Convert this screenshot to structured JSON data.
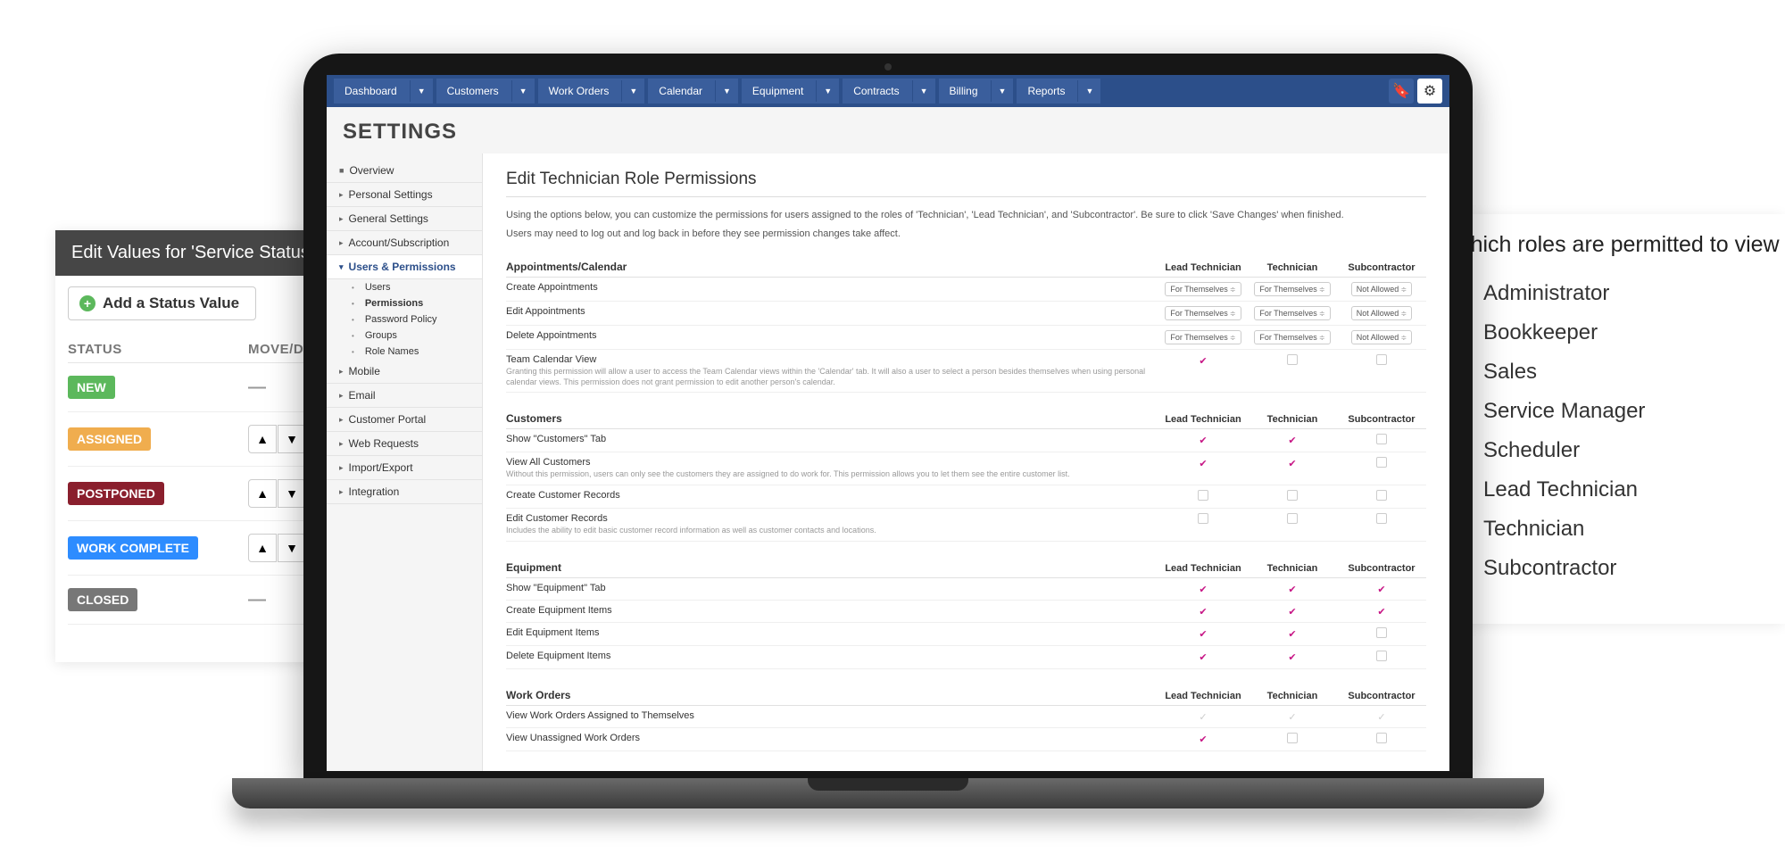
{
  "status_panel": {
    "title": "Edit Values for 'Service Status'",
    "add_button": "Add a Status Value",
    "col_status": "STATUS",
    "col_move": "MOVE/DELETE",
    "rows": [
      {
        "label": "NEW",
        "color": "#5cb85c",
        "movable": false
      },
      {
        "label": "ASSIGNED",
        "color": "#f0ad4e",
        "movable": true
      },
      {
        "label": "POSTPONED",
        "color": "#8a1f2d",
        "movable": true
      },
      {
        "label": "WORK COMPLETE",
        "color": "#2d8cff",
        "movable": true
      },
      {
        "label": "CLOSED",
        "color": "#777777",
        "movable": false
      }
    ]
  },
  "roles_panel": {
    "title": "Which roles are permitted to view",
    "roles": [
      {
        "label": "Administrator",
        "checked": true
      },
      {
        "label": "Bookkeeper",
        "checked": false
      },
      {
        "label": "Sales",
        "checked": false
      },
      {
        "label": "Service Manager",
        "checked": false
      },
      {
        "label": "Scheduler",
        "checked": false
      },
      {
        "label": "Lead Technician",
        "checked": false
      },
      {
        "label": "Technician",
        "checked": false
      },
      {
        "label": "Subcontractor",
        "checked": false
      }
    ]
  },
  "nav": {
    "items": [
      "Dashboard",
      "Customers",
      "Work Orders",
      "Calendar",
      "Equipment",
      "Contracts",
      "Billing",
      "Reports"
    ]
  },
  "page_title": "SETTINGS",
  "sidebar": {
    "items": [
      {
        "label": "Overview",
        "arrow": "■"
      },
      {
        "label": "Personal Settings",
        "arrow": "▸"
      },
      {
        "label": "General Settings",
        "arrow": "▸"
      },
      {
        "label": "Account/Subscription",
        "arrow": "▸"
      },
      {
        "label": "Users & Permissions",
        "arrow": "▾",
        "active": true,
        "subs": [
          {
            "label": "Users"
          },
          {
            "label": "Permissions",
            "active": true
          },
          {
            "label": "Password Policy"
          },
          {
            "label": "Groups"
          },
          {
            "label": "Role Names"
          }
        ]
      },
      {
        "label": "Mobile",
        "arrow": "▸"
      },
      {
        "label": "Email",
        "arrow": "▸"
      },
      {
        "label": "Customer Portal",
        "arrow": "▸"
      },
      {
        "label": "Web Requests",
        "arrow": "▸"
      },
      {
        "label": "Import/Export",
        "arrow": "▸"
      },
      {
        "label": "Integration",
        "arrow": "▸"
      }
    ]
  },
  "main": {
    "title": "Edit Technician Role Permissions",
    "desc1": "Using the options below, you can customize the permissions for users assigned to the roles of 'Technician', 'Lead Technician', and 'Subcontractor'. Be sure to click 'Save Changes' when finished.",
    "desc2": "Users may need to log out and log back in before they see permission changes take affect.",
    "cols": [
      "Lead Technician",
      "Technician",
      "Subcontractor"
    ],
    "sections": [
      {
        "title": "Appointments/Calendar",
        "rows": [
          {
            "label": "Create Appointments",
            "cells": [
              "select:For Themselves",
              "select:For Themselves",
              "select:Not Allowed"
            ]
          },
          {
            "label": "Edit Appointments",
            "cells": [
              "select:For Themselves",
              "select:For Themselves",
              "select:Not Allowed"
            ]
          },
          {
            "label": "Delete Appointments",
            "cells": [
              "select:For Themselves",
              "select:For Themselves",
              "select:Not Allowed"
            ]
          },
          {
            "label": "Team Calendar View",
            "sub": "Granting this permission will allow a user to access the Team Calendar views within the 'Calendar' tab. It will also a user to select a person besides themselves when using personal calendar views. This permission does not grant permission to edit another person's calendar.",
            "cells": [
              "on",
              "off",
              "off"
            ]
          }
        ]
      },
      {
        "title": "Customers",
        "rows": [
          {
            "label": "Show \"Customers\" Tab",
            "cells": [
              "on",
              "on",
              "off"
            ]
          },
          {
            "label": "View All Customers",
            "sub": "Without this permission, users can only see the customers they are assigned to do work for. This permission allows you to let them see the entire customer list.",
            "cells": [
              "on",
              "on",
              "off"
            ]
          },
          {
            "label": "Create Customer Records",
            "cells": [
              "off",
              "off",
              "off"
            ]
          },
          {
            "label": "Edit Customer Records",
            "sub": "Includes the ability to edit basic customer record information as well as customer contacts and locations.",
            "cells": [
              "off",
              "off",
              "off"
            ]
          }
        ]
      },
      {
        "title": "Equipment",
        "rows": [
          {
            "label": "Show \"Equipment\" Tab",
            "cells": [
              "on",
              "on",
              "on"
            ]
          },
          {
            "label": "Create Equipment Items",
            "cells": [
              "on",
              "on",
              "on"
            ]
          },
          {
            "label": "Edit Equipment Items",
            "cells": [
              "on",
              "on",
              "off"
            ]
          },
          {
            "label": "Delete Equipment Items",
            "cells": [
              "on",
              "on",
              "off"
            ]
          }
        ]
      },
      {
        "title": "Work Orders",
        "rows": [
          {
            "label": "View Work Orders Assigned to Themselves",
            "cells": [
              "faint",
              "faint",
              "faint"
            ]
          },
          {
            "label": "View Unassigned Work Orders",
            "cells": [
              "on",
              "off",
              "off"
            ]
          }
        ]
      }
    ]
  }
}
